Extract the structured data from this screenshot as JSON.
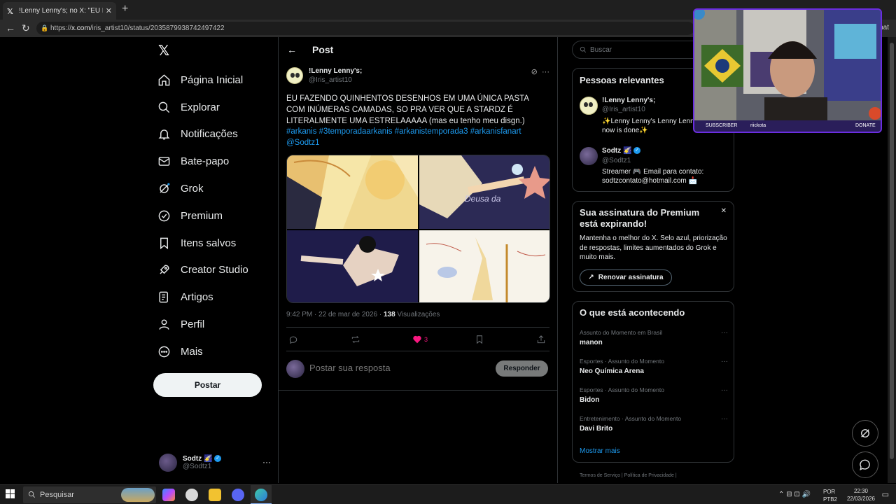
{
  "browser": {
    "tab_title": "!Lenny Lenny's; no X: \"EU FAZEND",
    "tab_close": "✕",
    "new_tab": "+",
    "url_host": "x.com",
    "url_path": "/iris_artist10/status/2035879938742497422",
    "url_scheme": "https://",
    "right_text": "hat"
  },
  "nav": {
    "items": [
      {
        "label": "Página Inicial",
        "icon": "home-icon"
      },
      {
        "label": "Explorar",
        "icon": "search-icon"
      },
      {
        "label": "Notificações",
        "icon": "bell-icon"
      },
      {
        "label": "Bate-papo",
        "icon": "mail-icon"
      },
      {
        "label": "Grok",
        "icon": "grok-icon"
      },
      {
        "label": "Premium",
        "icon": "premium-icon"
      },
      {
        "label": "Itens salvos",
        "icon": "bookmark-icon"
      },
      {
        "label": "Creator Studio",
        "icon": "rocket-icon"
      },
      {
        "label": "Artigos",
        "icon": "article-icon"
      },
      {
        "label": "Perfil",
        "icon": "person-icon"
      },
      {
        "label": "Mais",
        "icon": "more-icon"
      }
    ],
    "post_button": "Postar"
  },
  "account": {
    "name": "Sodtz 🌠",
    "handle": "@Sodtz1",
    "menu": "···"
  },
  "header": {
    "title": "Post"
  },
  "post": {
    "author_name": "!Lenny Lenny's;",
    "author_handle": "@Iris_artist10",
    "text": "EU FAZENDO QUINHENTOS DESENHOS EM UMA ÚNICA PASTA COM INÚMERAS CAMADAS, SO PRA VER QUE A STARDZ É LITERALMENTE UMA ESTRELAAAAA (mas eu tenho meu disgn.)",
    "tags": "#arkanis #3temporadaarkanis #arkanistemporada3 #arkanisfanart @Sodtz1",
    "time": "9:42 PM · 22 de mar de 2026 · ",
    "views_count": "138",
    "views_label": " Visualizações",
    "like_count": "3",
    "media_text": "Deusa da"
  },
  "reply": {
    "placeholder": "Postar sua resposta",
    "button": "Responder"
  },
  "search": {
    "placeholder": "Buscar"
  },
  "relevant": {
    "title": "Pessoas relevantes",
    "people": [
      {
        "name": "!Lenny Lenny's;",
        "handle": "@Iris_artist10",
        "bio": "✨Lenny Lenny's Lenny Lenny now is done✨"
      },
      {
        "name": "Sodtz 🌠",
        "handle": "@Sodtz1",
        "bio": "Streamer 🎮 Email para contato: sodtzcontato@hotmail.com 📩"
      }
    ]
  },
  "premium": {
    "title": "Sua assinatura do Premium está expirando!",
    "text": "Mantenha o melhor do X. Selo azul, priorização de respostas, limites aumentados do Grok e muito mais.",
    "button": "Renovar assinatura",
    "close": "✕"
  },
  "trends": {
    "title": "O que está acontecendo",
    "items": [
      {
        "category": "Assunto do Momento em Brasil",
        "name": "manon"
      },
      {
        "category": "Esportes · Assunto do Momento",
        "name": "Neo Química Arena"
      },
      {
        "category": "Esportes · Assunto do Momento",
        "name": "Bidon"
      },
      {
        "category": "Entretenimento · Assunto do Momento",
        "name": "Davi Brito"
      }
    ],
    "show_more": "Mostrar mais"
  },
  "footer": {
    "links": "Termos de Serviço  |  Política de Privacidade  |"
  },
  "webcam": {
    "label_left": "SUBSCRIBER",
    "label_center": "riickota",
    "label_right": "DONATE"
  },
  "taskbar": {
    "search": "Pesquisar",
    "lang1": "POR",
    "lang2": "PTB2",
    "time": "22:30",
    "date": "22/03/2026"
  },
  "colors": {
    "accent": "#1d9bf0",
    "like": "#f91880",
    "background": "#000000"
  }
}
